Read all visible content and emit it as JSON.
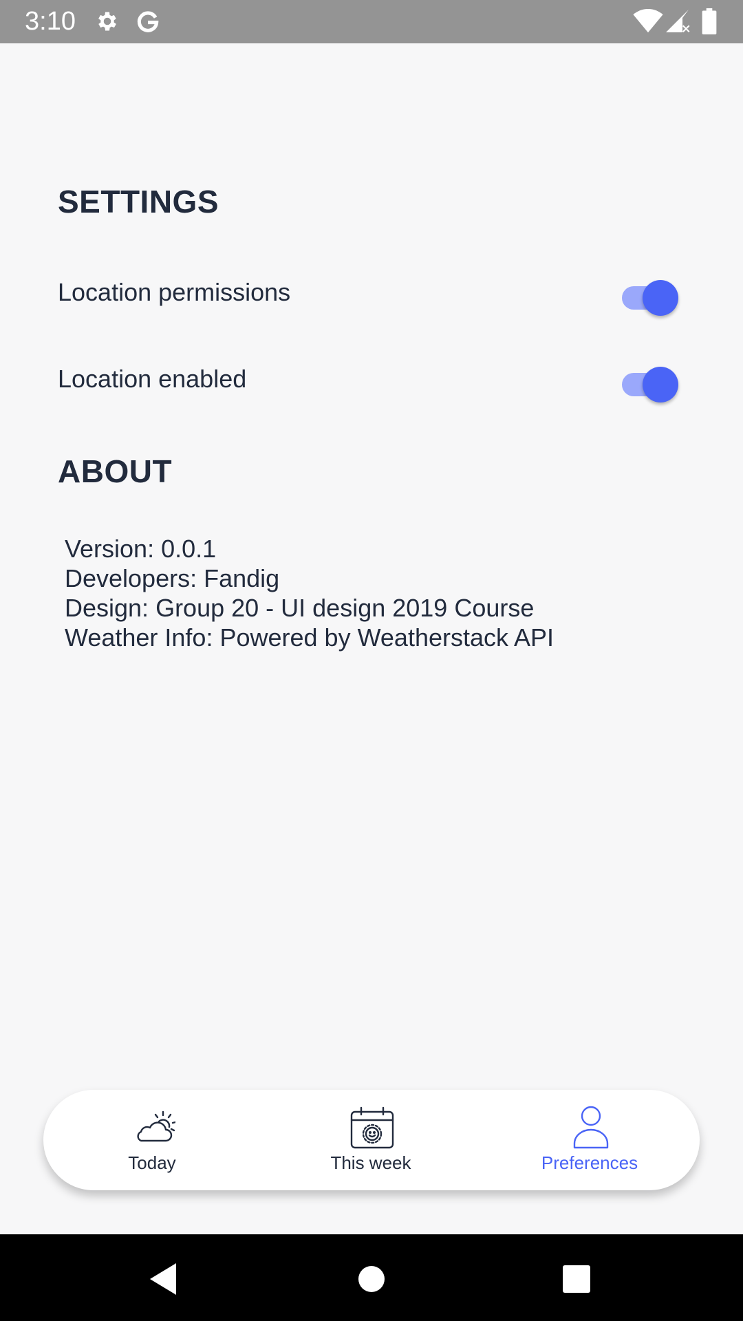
{
  "status_bar": {
    "time": "3:10",
    "icons": [
      "gear-icon",
      "google-icon",
      "wifi-icon",
      "signal-icon",
      "battery-icon"
    ]
  },
  "settings": {
    "title": "SETTINGS",
    "items": [
      {
        "label": "Location permissions",
        "enabled": true
      },
      {
        "label": "Location enabled",
        "enabled": true
      }
    ]
  },
  "about": {
    "title": "ABOUT",
    "lines": [
      "Version: 0.0.1",
      "Developers: Fandig",
      "Design: Group 20 - UI design 2019 Course",
      "Weather Info: Powered by Weatherstack API"
    ]
  },
  "bottom_nav": {
    "items": [
      {
        "label": "Today",
        "icon": "cloud-sun-icon",
        "active": false
      },
      {
        "label": "This week",
        "icon": "calendar-icon",
        "active": false
      },
      {
        "label": "Preferences",
        "icon": "person-icon",
        "active": true
      }
    ]
  },
  "colors": {
    "accent": "#4a64f6",
    "accent_track": "#9aa8fb",
    "text": "#222b3d",
    "background": "#f7f7f8",
    "status_bar": "#949494"
  }
}
